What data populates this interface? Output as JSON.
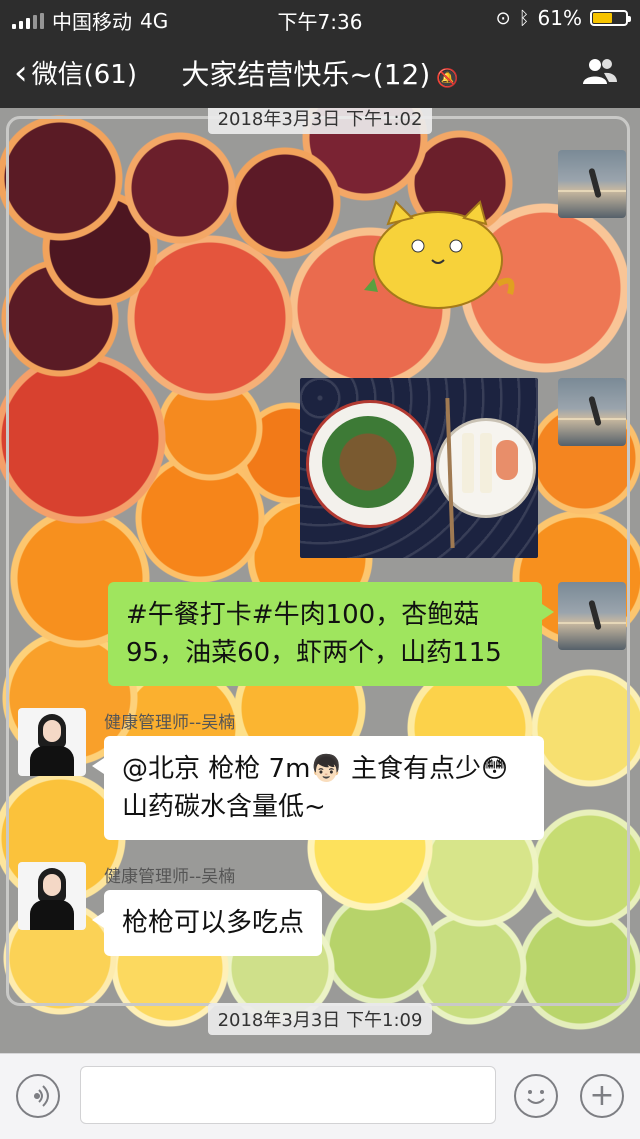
{
  "status_bar": {
    "carrier": "中国移动",
    "network": "4G",
    "time": "下午7:36",
    "battery": "61%",
    "battery_level": 0.61
  },
  "nav": {
    "back_label": "微信(61)",
    "title": "大家结营快乐~(12)"
  },
  "timestamps": {
    "top": "2018年3月3日 下午1:02",
    "bottom": "2018年3月3日 下午1:09"
  },
  "messages": [
    {
      "sender": "",
      "type": "sticker",
      "description": "cat-sticker"
    },
    {
      "sender": "",
      "type": "image",
      "description": "lunch-photo"
    },
    {
      "sender": "",
      "type": "text",
      "text": "#午餐打卡#牛肉100，杏鲍菇95，油菜60，虾两个，山药115"
    },
    {
      "sender": "健康管理师--吴楠",
      "type": "text",
      "line1": "@北京 枪枪 7m👦🏻 主食有点少😳",
      "line2": "山药碳水含量低~"
    },
    {
      "sender": "健康管理师--吴楠",
      "type": "text",
      "text": "枪枪可以多吃点"
    }
  ],
  "colors": {
    "bar_bg": "#2d2d2d",
    "self_bubble": "#9fe55e",
    "other_bubble": "#ffffff",
    "battery": "#f7c400"
  },
  "icons": {
    "voice": "voice-icon",
    "emoji": "emoji-icon",
    "add": "add-icon",
    "group": "group-members-icon"
  }
}
